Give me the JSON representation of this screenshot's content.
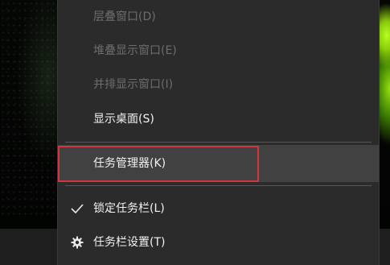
{
  "context_menu": {
    "items": [
      {
        "label": "层叠窗口(D)",
        "enabled": false
      },
      {
        "label": "堆叠显示窗口(E)",
        "enabled": false
      },
      {
        "label": "并排显示窗口(I)",
        "enabled": false
      },
      {
        "label": "显示桌面(S)",
        "enabled": true
      },
      {
        "label": "任务管理器(K)",
        "enabled": true,
        "highlighted": true
      },
      {
        "label": "锁定任务栏(L)",
        "enabled": true,
        "checked": true,
        "icon": "checkmark-icon"
      },
      {
        "label": "任务栏设置(T)",
        "enabled": true,
        "icon": "gear-icon"
      }
    ]
  },
  "colors": {
    "menu_background": "#2b2b2b",
    "menu_hover": "#414141",
    "disabled_text": "#6d6d6d",
    "enabled_text": "#f2f2f2",
    "focus_outline": "#d6343b"
  }
}
